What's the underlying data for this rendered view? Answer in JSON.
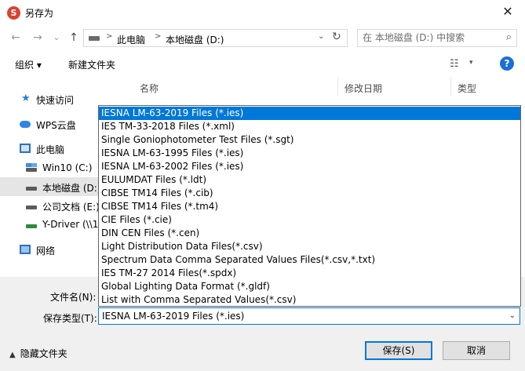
{
  "window": {
    "title": "另存为",
    "close_glyph": "✕"
  },
  "nav": {
    "back_glyph": "←",
    "forward_glyph": "→",
    "recent_glyph": "⌄",
    "up_glyph": "↑",
    "breadcrumb": [
      "此电脑",
      "本地磁盘 (D:)"
    ],
    "breadcrumb_sep": ">",
    "dropdown_glyph": "⌄",
    "refresh_glyph": "↻",
    "search_placeholder": "在 本地磁盘 (D:) 中搜索"
  },
  "toolbar": {
    "organize": "组织 ▾",
    "new_folder": "新建文件夹",
    "view_glyph": "☷",
    "view_dd": "▾",
    "help": "?"
  },
  "sidebar": {
    "items": [
      {
        "label": "快速访问",
        "icon": "star-icon"
      },
      {
        "label": "WPS云盘",
        "icon": "cloud-icon"
      },
      {
        "label": "此电脑",
        "icon": "computer-icon"
      },
      {
        "label": "Win10 (C:)",
        "icon": "windows-drive-icon"
      },
      {
        "label": "本地磁盘 (D:)",
        "icon": "drive-icon"
      },
      {
        "label": "公司文档 (E:)",
        "icon": "drive-icon"
      },
      {
        "label": "Y-Driver (\\\\1",
        "icon": "network-drive-icon"
      },
      {
        "label": "网络",
        "icon": "network-icon"
      }
    ]
  },
  "columns": {
    "name": "名称",
    "modified": "修改日期",
    "type": "类型"
  },
  "form": {
    "filename_label": "文件名(N):",
    "filetype_label": "保存类型(T):",
    "filetype_value": "IESNA LM-63-2019 Files (*.ies)"
  },
  "filetype_options": [
    "IESNA LM-63-2019 Files (*.ies)",
    "IES TM-33-2018 Files (*.xml)",
    "Single Goniophotometer Test Files (*.sgt)",
    "IESNA LM-63-1995 Files (*.ies)",
    "IESNA LM-63-2002 Files (*.ies)",
    "EULUMDAT Files (*.ldt)",
    "CIBSE TM14 Files (*.cib)",
    "CIBSE TM14 Files (*.tm4)",
    "CIE Files (*.cie)",
    "DIN CEN Files (*.cen)",
    "Light Distribution Data Files(*.csv)",
    "Spectrum Data Comma Separated Values Files(*.csv,*.txt)",
    "IES TM-27 2014 Files(*.spdx)",
    "Global Lighting Data Format (*.gldf)",
    "List with Comma Separated Values(*.csv)"
  ],
  "footer": {
    "hide_folders": "隐藏文件夹",
    "hide_glyph": "▲",
    "save": "保存(S)",
    "cancel": "取消"
  },
  "colors": {
    "accent": "#0078d7",
    "help": "#1a6fd6"
  }
}
